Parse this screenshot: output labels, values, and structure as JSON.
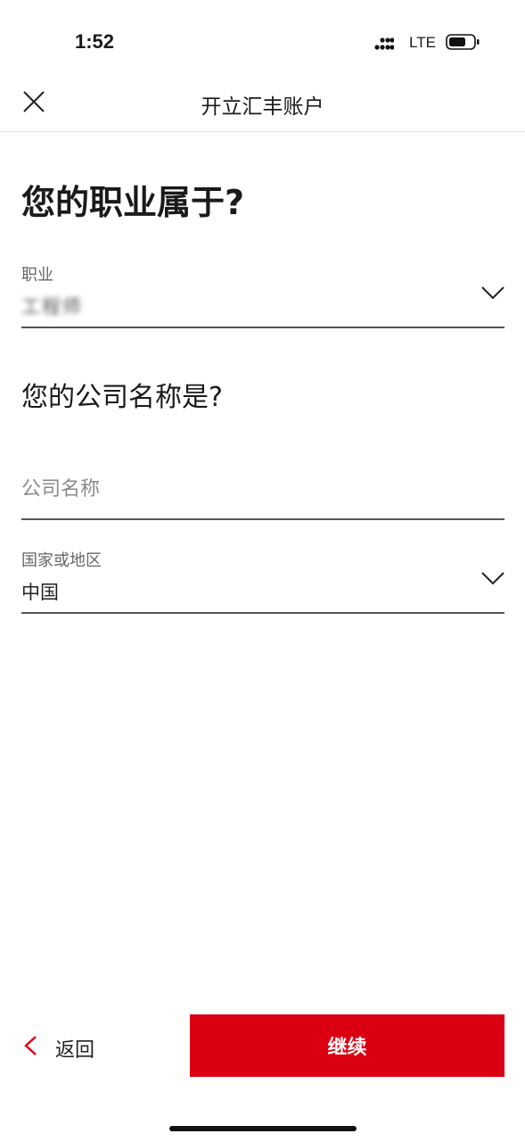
{
  "status_bar": {
    "time": "1:52",
    "network": "LTE"
  },
  "header": {
    "title": "开立汇丰账户"
  },
  "occupation_section": {
    "question": "您的职业属于?",
    "label": "职业",
    "value": "工程师"
  },
  "company_section": {
    "question": "您的公司名称是?",
    "company_placeholder": "公司名称",
    "country_label": "国家或地区",
    "country_value": "中国"
  },
  "footer": {
    "back_label": "返回",
    "continue_label": "继续"
  },
  "colors": {
    "accent": "#db0011"
  }
}
